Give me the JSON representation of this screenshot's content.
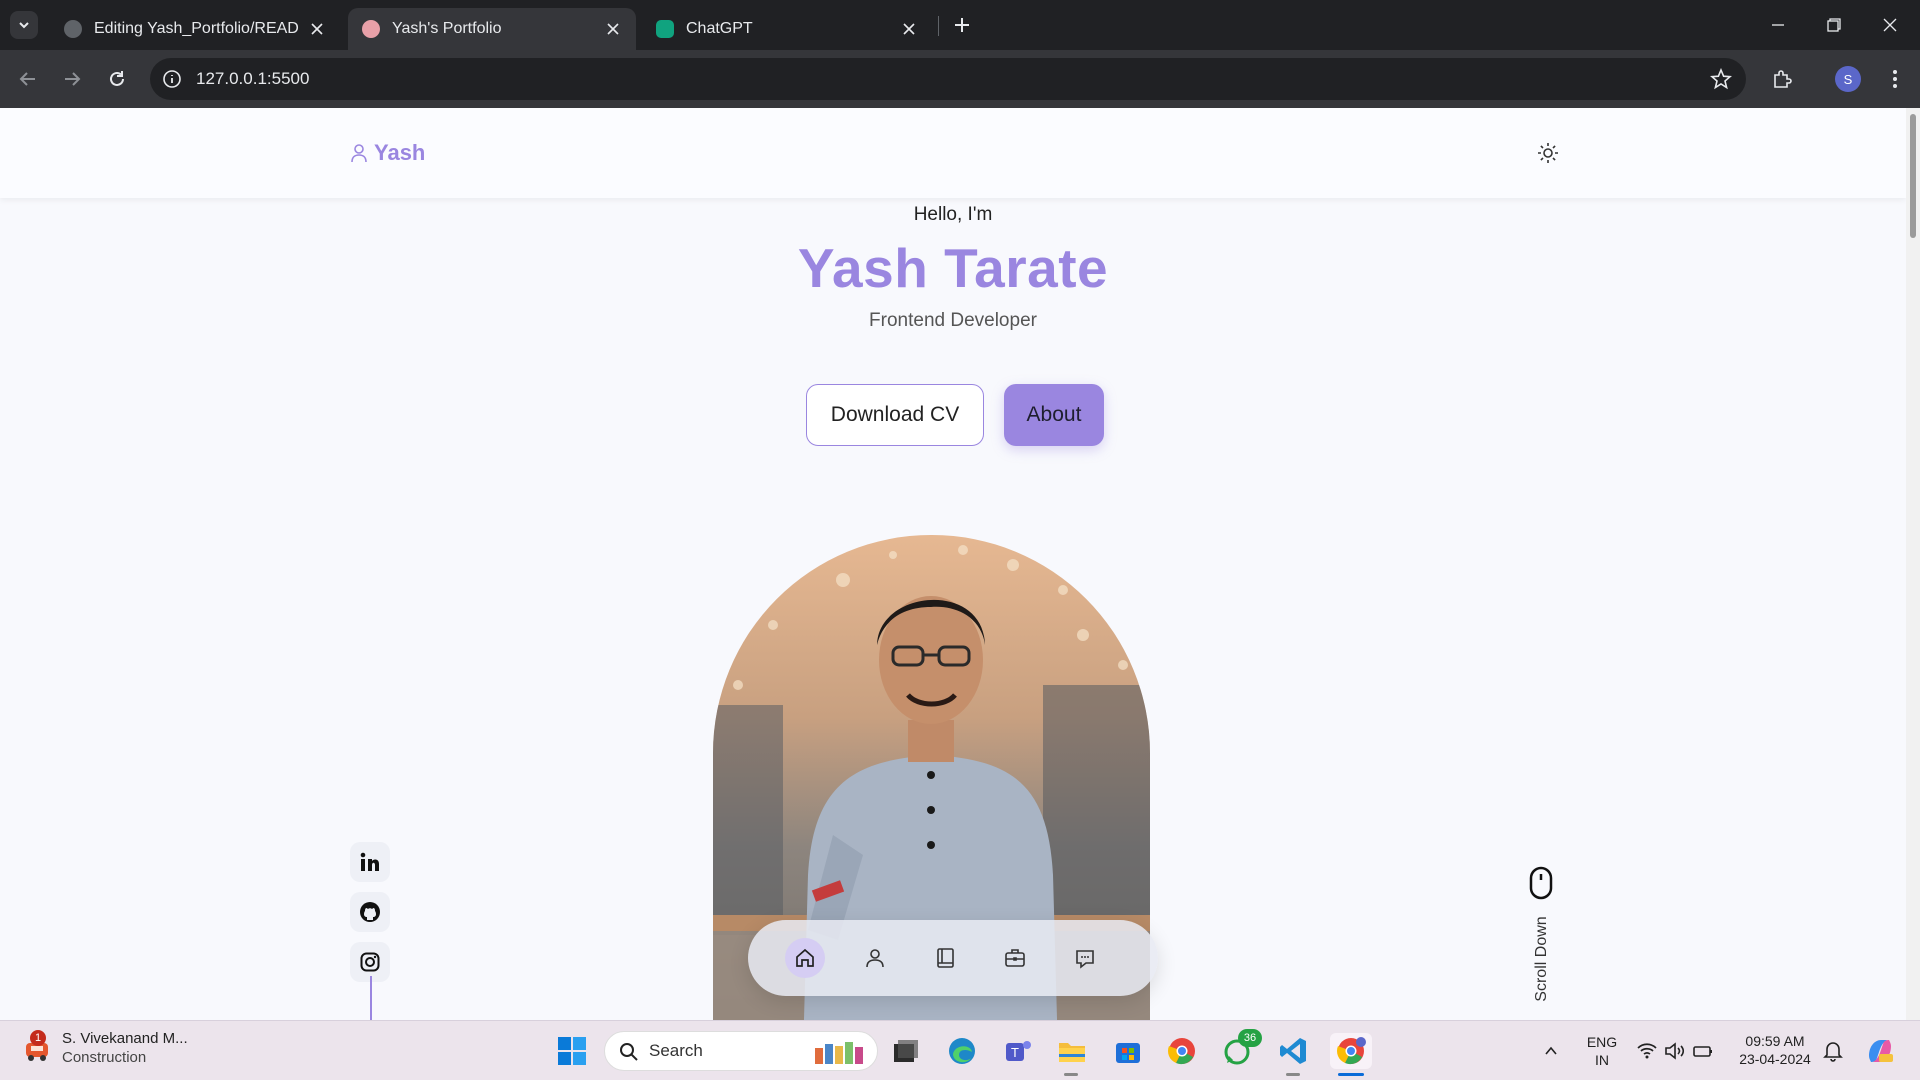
{
  "browser": {
    "tabs": [
      {
        "label": "Editing Yash_Portfolio/README.m",
        "favicon": "github-favicon",
        "active": false
      },
      {
        "label": "Yash's Portfolio",
        "favicon": "portfolio-favicon",
        "active": true
      },
      {
        "label": "ChatGPT",
        "favicon": "chatgpt-favicon",
        "active": false
      }
    ],
    "url": "127.0.0.1:5500",
    "profile_initial": "S"
  },
  "site": {
    "logo_text": "Yash",
    "greeting": "Hello, I'm",
    "name": "Yash Tarate",
    "role": "Frontend Developer",
    "buttons": {
      "cv": "Download CV",
      "about": "About"
    },
    "socials": [
      "linkedin-icon",
      "github-icon",
      "instagram-icon"
    ],
    "scroll_label": "Scroll Down",
    "nav": [
      "home-icon",
      "user-icon",
      "book-icon",
      "briefcase-icon",
      "message-icon"
    ],
    "active_nav": "home-icon",
    "accent_color": "#9a86e0"
  },
  "taskbar": {
    "weather_title": "S. Vivekanand M...",
    "weather_sub": "Construction",
    "weather_badge": "1",
    "search_label": "Search",
    "whatsapp_badge": "36",
    "lang_line1": "ENG",
    "lang_line2": "IN",
    "time": "09:59 AM",
    "date": "23-04-2024"
  }
}
